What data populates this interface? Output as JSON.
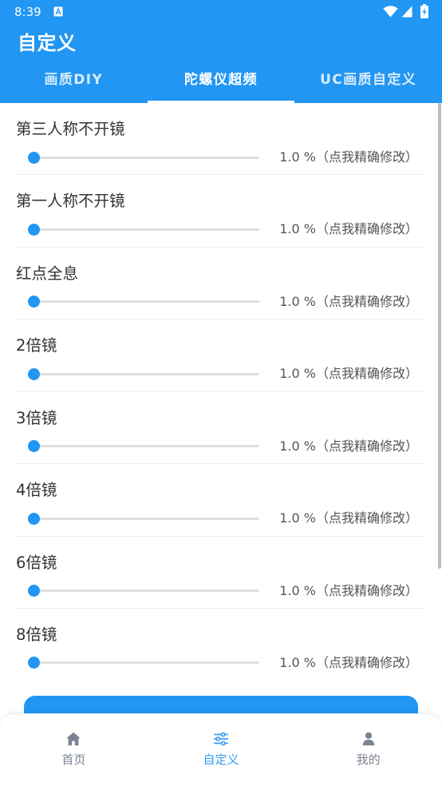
{
  "status_bar": {
    "time": "8:39",
    "left_icons": [
      "a-notification-icon"
    ],
    "right_icons": [
      "wifi-icon",
      "cell-signal-icon",
      "battery-charging-icon"
    ]
  },
  "app_bar": {
    "title": "自定义"
  },
  "tabs": [
    {
      "label": "画质DIY",
      "selected": false
    },
    {
      "label": "陀螺仪超频",
      "selected": true
    },
    {
      "label": "UC画质自定义",
      "selected": false
    }
  ],
  "settings": [
    {
      "label": "第三人称不开镜",
      "value": "1.0",
      "unit": "%",
      "hint": "（点我精确修改）",
      "level": 0.0
    },
    {
      "label": "第一人称不开镜",
      "value": "1.0",
      "unit": "%",
      "hint": "（点我精确修改）",
      "level": 0.0
    },
    {
      "label": "红点全息",
      "value": "1.0",
      "unit": "%",
      "hint": "（点我精确修改）",
      "level": 0.0
    },
    {
      "label": "2倍镜",
      "value": "1.0",
      "unit": "%",
      "hint": "（点我精确修改）",
      "level": 0.0
    },
    {
      "label": "3倍镜",
      "value": "1.0",
      "unit": "%",
      "hint": "（点我精确修改）",
      "level": 0.0
    },
    {
      "label": "4倍镜",
      "value": "1.0",
      "unit": "%",
      "hint": "（点我精确修改）",
      "level": 0.0
    },
    {
      "label": "6倍镜",
      "value": "1.0",
      "unit": "%",
      "hint": "（点我精确修改）",
      "level": 0.0
    },
    {
      "label": "8倍镜",
      "value": "1.0",
      "unit": "%",
      "hint": "（点我精确修改）",
      "level": 0.0
    }
  ],
  "bottom_nav": [
    {
      "label": "首页",
      "icon": "home-icon",
      "active": false
    },
    {
      "label": "自定义",
      "icon": "tune-icon",
      "active": true
    },
    {
      "label": "我的",
      "icon": "person-icon",
      "active": false
    }
  ],
  "colors": {
    "primary": "#2196F3",
    "primary_light": "#3A9CF5",
    "label_text": "#333333",
    "value_text": "#555555",
    "nav_inactive": "#7B8494",
    "slider_track": "#DEDEDE",
    "divider": "#EEEEEE",
    "scrollbar": "#BDBDBD"
  }
}
